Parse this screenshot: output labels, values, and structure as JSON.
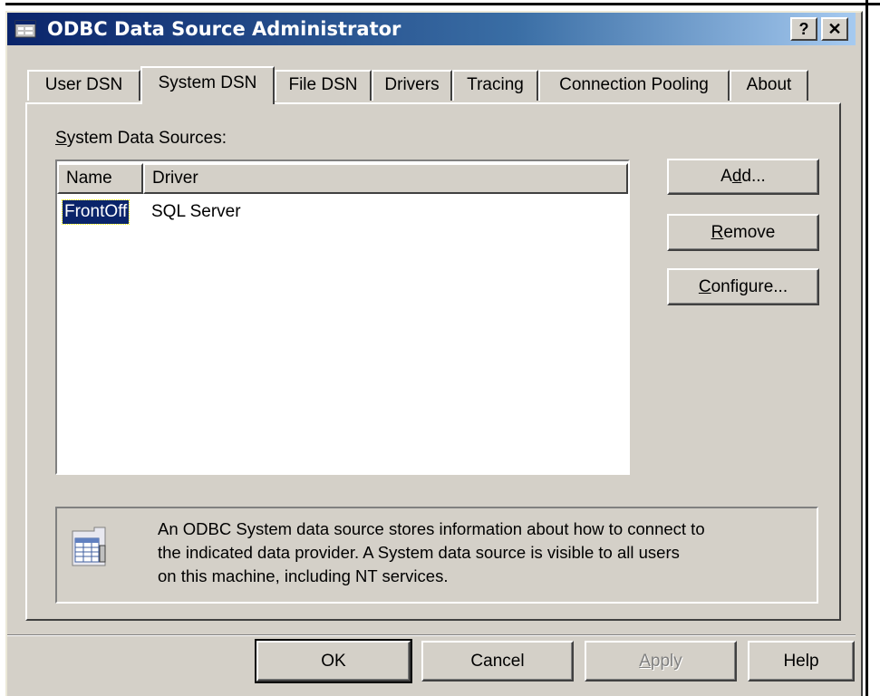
{
  "window": {
    "title": "ODBC Data Source Administrator",
    "help_button": "?",
    "close_button": "✕"
  },
  "tabs": [
    {
      "label": "User DSN",
      "active": false
    },
    {
      "label": "System DSN",
      "active": true
    },
    {
      "label": "File DSN",
      "active": false
    },
    {
      "label": "Drivers",
      "active": false
    },
    {
      "label": "Tracing",
      "active": false
    },
    {
      "label": "Connection Pooling",
      "active": false
    },
    {
      "label": "About",
      "active": false
    }
  ],
  "panel": {
    "sources_label_mnemonic": "S",
    "sources_label_rest": "ystem Data Sources:",
    "columns": [
      "Name",
      "Driver"
    ],
    "rows": [
      {
        "name": "FrontOff",
        "driver": "SQL Server",
        "selected": true
      }
    ],
    "buttons": {
      "add_pre": "A",
      "add_mnemonic": "d",
      "add_post": "d...",
      "remove_mnemonic": "R",
      "remove_post": "emove",
      "configure_mnemonic": "C",
      "configure_post": "onfigure..."
    },
    "info_line1": "An ODBC System data source stores information about how to connect to",
    "info_line2": "the indicated data provider.   A System data source is visible to all users",
    "info_line3": "on this machine, including NT services.",
    "info_icon": "data-source-icon"
  },
  "footer": {
    "ok": "OK",
    "cancel": "Cancel",
    "apply_mnemonic": "A",
    "apply_post": "pply",
    "help": "Help"
  },
  "colors": {
    "face": "#d4d0c8",
    "title_start": "#0a246a",
    "title_end": "#a6caf0",
    "selection": "#0a246a"
  }
}
